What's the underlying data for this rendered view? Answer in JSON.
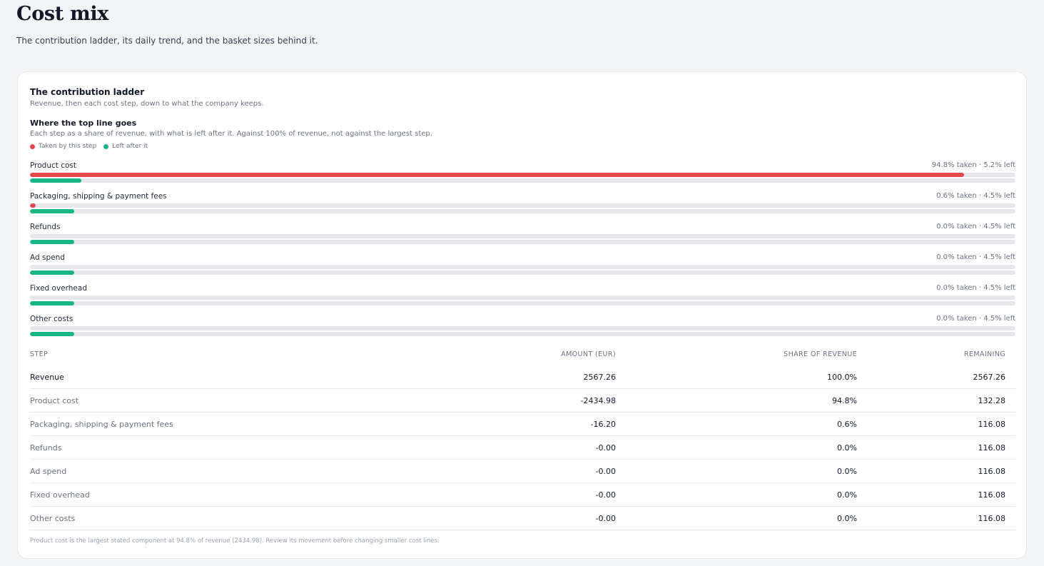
{
  "page": {
    "title": "Cost mix",
    "subtitle": "The contribution ladder, its daily trend, and the basket sizes behind it."
  },
  "card": {
    "title": "The contribution ladder",
    "subtitle": "Revenue, then each cost step, down to what the company keeps.",
    "section_title": "Where the top line goes",
    "section_subtitle": "Each step as a share of revenue, with what is left after it. Against 100% of revenue, not against the largest step.",
    "legend": {
      "taken_label": "Taken by this step",
      "left_label": "Left after it",
      "taken_color": "#e5484d",
      "left_color": "#17b684"
    },
    "ladder": [
      {
        "label": "Product cost",
        "summary": "94.8% taken · 5.2% left",
        "taken_pct": 94.8,
        "left_pct": 5.2
      },
      {
        "label": "Packaging, shipping & payment fees",
        "summary": "0.6% taken · 4.5% left",
        "taken_pct": 0.6,
        "left_pct": 4.5
      },
      {
        "label": "Refunds",
        "summary": "0.0% taken · 4.5% left",
        "taken_pct": 0.0,
        "left_pct": 4.5
      },
      {
        "label": "Ad spend",
        "summary": "0.0% taken · 4.5% left",
        "taken_pct": 0.0,
        "left_pct": 4.5
      },
      {
        "label": "Fixed overhead",
        "summary": "0.0% taken · 4.5% left",
        "taken_pct": 0.0,
        "left_pct": 4.5
      },
      {
        "label": "Other costs",
        "summary": "0.0% taken · 4.5% left",
        "taken_pct": 0.0,
        "left_pct": 4.5
      }
    ],
    "table": {
      "headers": [
        "STEP",
        "AMOUNT (EUR)",
        "SHARE OF REVENUE",
        "REMAINING"
      ],
      "rows": [
        {
          "step": "Revenue",
          "amount": "2567.26",
          "share": "100.0%",
          "remaining": "2567.26"
        },
        {
          "step": "Product cost",
          "amount": "-2434.98",
          "share": "94.8%",
          "remaining": "132.28"
        },
        {
          "step": "Packaging, shipping & payment fees",
          "amount": "-16.20",
          "share": "0.6%",
          "remaining": "116.08"
        },
        {
          "step": "Refunds",
          "amount": "-0.00",
          "share": "0.0%",
          "remaining": "116.08"
        },
        {
          "step": "Ad spend",
          "amount": "-0.00",
          "share": "0.0%",
          "remaining": "116.08"
        },
        {
          "step": "Fixed overhead",
          "amount": "-0.00",
          "share": "0.0%",
          "remaining": "116.08"
        },
        {
          "step": "Other costs",
          "amount": "-0.00",
          "share": "0.0%",
          "remaining": "116.08"
        }
      ]
    },
    "footnote": "Product cost is the largest stated component at 94.8% of revenue (2434.98). Review its movement before changing smaller cost lines."
  }
}
